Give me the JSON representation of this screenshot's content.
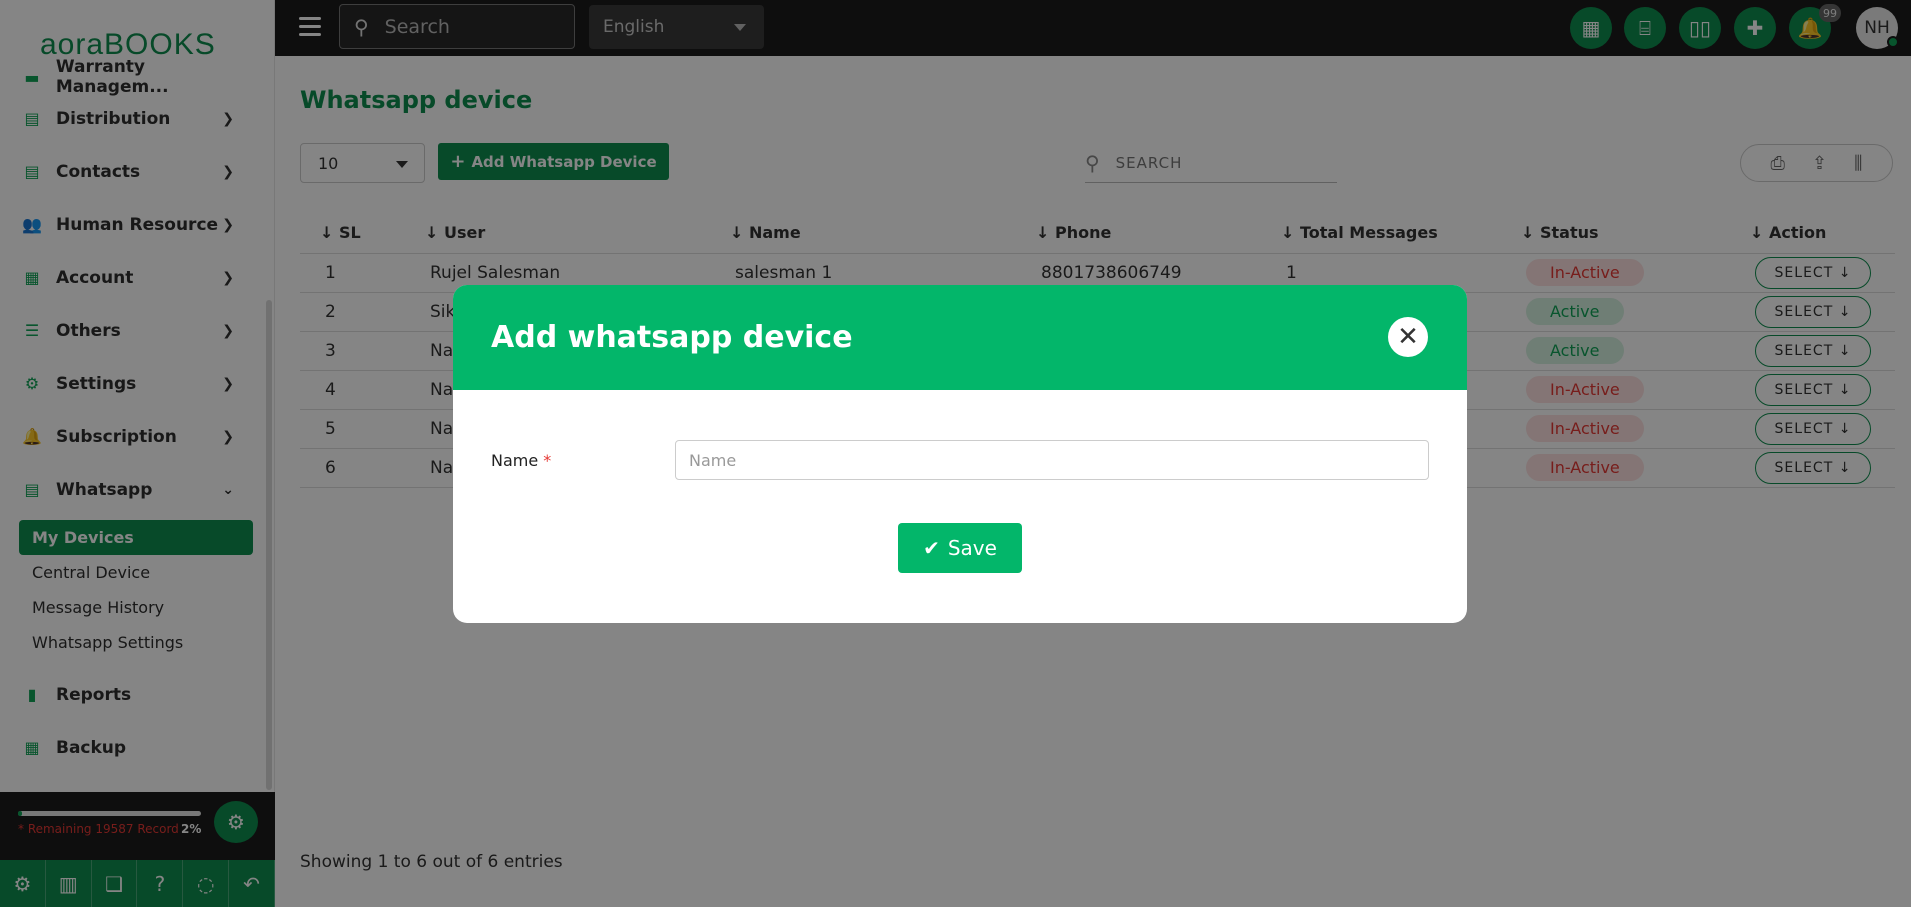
{
  "brand": {
    "part1": "aora",
    "part2": "BOOKS"
  },
  "sidebar": {
    "cut_item": "Warranty Managem...",
    "items": [
      {
        "label": "Distribution",
        "icon": "document-icon"
      },
      {
        "label": "Contacts",
        "icon": "document-icon"
      },
      {
        "label": "Human Resource",
        "icon": "users-icon"
      },
      {
        "label": "Account",
        "icon": "calculator-icon"
      },
      {
        "label": "Others",
        "icon": "list-icon"
      },
      {
        "label": "Settings",
        "icon": "gear-icon"
      },
      {
        "label": "Subscription",
        "icon": "bell-icon"
      },
      {
        "label": "Whatsapp",
        "icon": "document-icon"
      }
    ],
    "whatsapp_sub": [
      "My Devices",
      "Central Device",
      "Message History",
      "Whatsapp Settings"
    ],
    "after_items": [
      {
        "label": "Reports",
        "icon": "bar-chart-icon"
      },
      {
        "label": "Backup",
        "icon": "grid-icon"
      }
    ],
    "quota": {
      "text": "* Remaining 19587 Record",
      "percent_label": "2%",
      "percent": 2
    }
  },
  "topbar": {
    "search_placeholder": "Search",
    "language": "English",
    "notification_count": "99",
    "avatar_initials": "NH"
  },
  "page": {
    "title": "Whatsapp device",
    "page_size": "10",
    "add_button": "Add Whatsapp Device",
    "search_placeholder": "SEARCH",
    "columns": [
      "SL",
      "User",
      "Name",
      "Phone",
      "Total Messages",
      "Status",
      "Action"
    ],
    "rows": [
      {
        "sl": "1",
        "user": "Rujel Salesman",
        "name": "salesman 1",
        "phone": "8801738606749",
        "total": "1",
        "status": "In-Active",
        "action": "SELECT"
      },
      {
        "sl": "2",
        "user": "Sik",
        "name": "",
        "phone": "",
        "total": "",
        "status": "Active",
        "action": "SELECT"
      },
      {
        "sl": "3",
        "user": "Na",
        "name": "",
        "phone": "",
        "total": "",
        "status": "Active",
        "action": "SELECT"
      },
      {
        "sl": "4",
        "user": "Na",
        "name": "",
        "phone": "",
        "total": "",
        "status": "In-Active",
        "action": "SELECT"
      },
      {
        "sl": "5",
        "user": "Na",
        "name": "",
        "phone": "",
        "total": "",
        "status": "In-Active",
        "action": "SELECT"
      },
      {
        "sl": "6",
        "user": "Na",
        "name": "",
        "phone": "",
        "total": "",
        "status": "In-Active",
        "action": "SELECT"
      }
    ],
    "footer": "Showing 1 to 6 out of 6 entries"
  },
  "modal": {
    "title": "Add whatsapp device",
    "field_label": "Name",
    "required_mark": "*",
    "field_placeholder": "Name",
    "field_value": "",
    "save_label": "Save"
  },
  "colors": {
    "brand_green": "#0f8f4f",
    "modal_green": "#03b66a",
    "inactive_red": "#e53935"
  }
}
